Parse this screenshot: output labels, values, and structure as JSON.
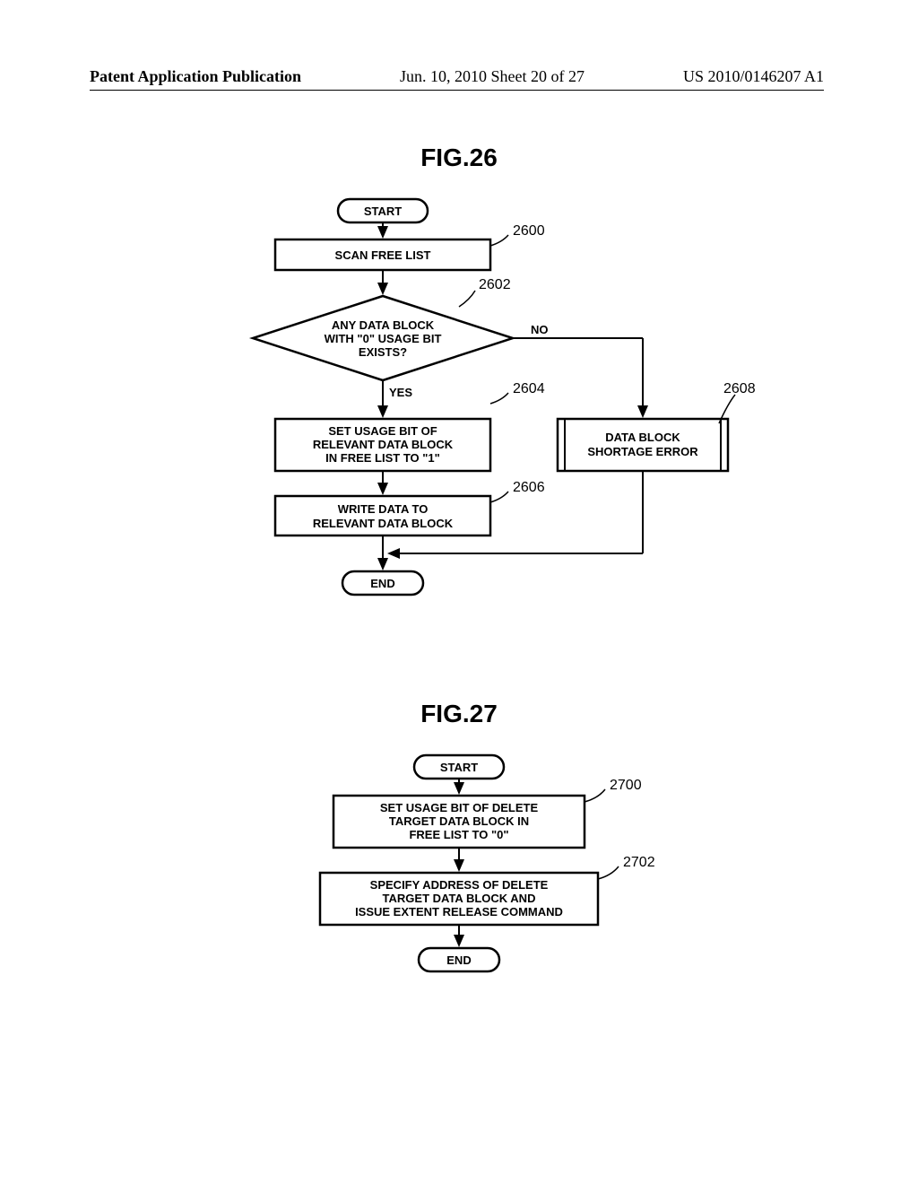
{
  "header": {
    "left": "Patent Application Publication",
    "center": "Jun. 10, 2010  Sheet 20 of 27",
    "right": "US 2010/0146207 A1"
  },
  "fig26": {
    "title": "FIG.26",
    "start": "START",
    "end": "END",
    "step2600": "SCAN FREE LIST",
    "ref2600": "2600",
    "decision2602": "ANY DATA BLOCK WITH \"0\" USAGE BIT EXISTS?",
    "dec_line1": "ANY DATA BLOCK",
    "dec_line2": "WITH \"0\" USAGE BIT",
    "dec_line3": "EXISTS?",
    "ref2602": "2602",
    "yes": "YES",
    "no": "NO",
    "step2604_l1": "SET USAGE BIT OF",
    "step2604_l2": "RELEVANT DATA BLOCK",
    "step2604_l3": "IN FREE LIST TO \"1\"",
    "ref2604": "2604",
    "step2606_l1": "WRITE DATA TO",
    "step2606_l2": "RELEVANT DATA BLOCK",
    "ref2606": "2606",
    "step2608_l1": "DATA BLOCK",
    "step2608_l2": "SHORTAGE ERROR",
    "ref2608": "2608"
  },
  "fig27": {
    "title": "FIG.27",
    "start": "START",
    "end": "END",
    "step2700_l1": "SET USAGE BIT OF DELETE",
    "step2700_l2": "TARGET DATA BLOCK IN",
    "step2700_l3": "FREE LIST TO \"0\"",
    "ref2700": "2700",
    "step2702_l1": "SPECIFY ADDRESS OF DELETE",
    "step2702_l2": "TARGET DATA BLOCK AND",
    "step2702_l3": "ISSUE EXTENT RELEASE COMMAND",
    "ref2702": "2702"
  }
}
